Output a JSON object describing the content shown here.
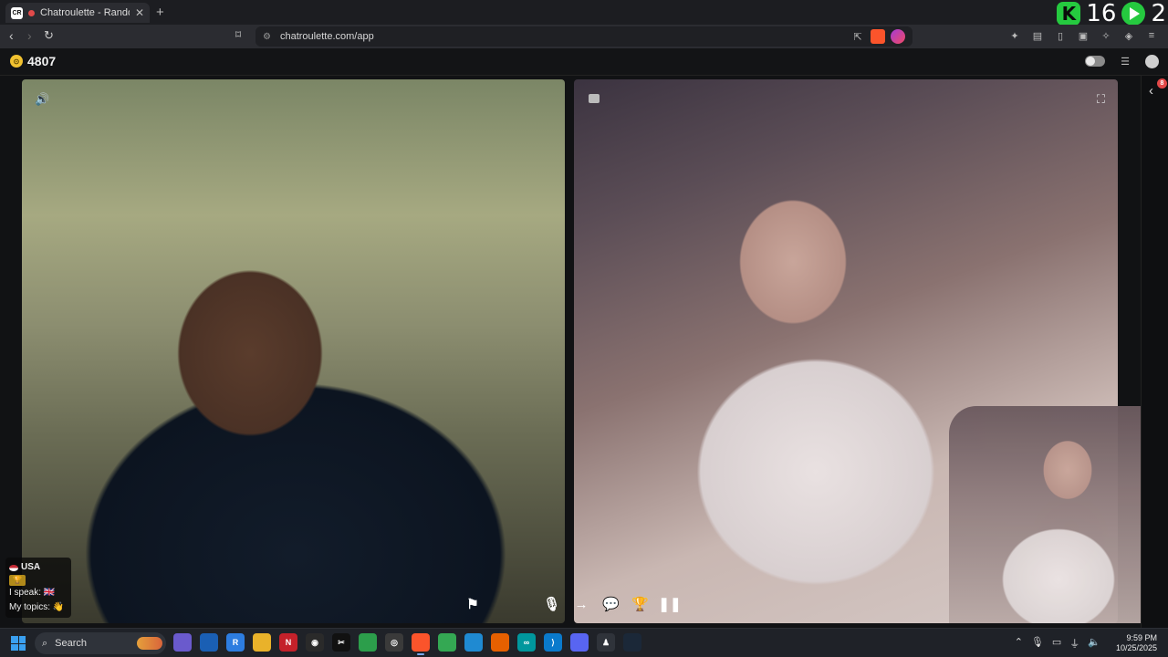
{
  "browser": {
    "tab_title": "Chatroulette - Random video",
    "tab_favicon": "CR",
    "url": "chatroulette.com/app",
    "tab_close": "✕",
    "new_tab": "+"
  },
  "overlay": {
    "counter_k_icon": "K",
    "counter_k": "16",
    "counter_play": "2"
  },
  "app": {
    "coins": "4807",
    "coin_icon": "coin-icon",
    "notifications_badge": "8"
  },
  "partner": {
    "country": "USA",
    "speaks_label": "I speak:",
    "topics_label": "My topics:",
    "topics_emoji": "👋",
    "speaks_flag": "🇬🇧"
  },
  "controls": [
    "flag-icon",
    "microphone-icon",
    "next-arrow-icon",
    "chat-icon",
    "gift-icon",
    "pause-icon"
  ],
  "taskbar": {
    "search_placeholder": "Search",
    "time": "9:59 PM",
    "date": "10/25/2025",
    "apps": [
      {
        "name": "app-copilot",
        "color": "#6a5acd",
        "label": ""
      },
      {
        "name": "app-outlook",
        "color": "#1a5fb4",
        "label": ""
      },
      {
        "name": "app-remote",
        "color": "#2d7de0",
        "label": "R"
      },
      {
        "name": "app-explorer",
        "color": "#e9b22a",
        "label": ""
      },
      {
        "name": "app-netflix",
        "color": "#c4212a",
        "label": "N"
      },
      {
        "name": "app-obs",
        "color": "#2a2a2a",
        "label": "◉"
      },
      {
        "name": "app-capcut",
        "color": "#111111",
        "label": "✂"
      },
      {
        "name": "app-maps",
        "color": "#2c9e4b",
        "label": ""
      },
      {
        "name": "app-obs2",
        "color": "#3a3a3a",
        "label": "◎"
      },
      {
        "name": "app-brave",
        "color": "#fb542b",
        "label": ""
      },
      {
        "name": "app-chrome",
        "color": "#34a853",
        "label": ""
      },
      {
        "name": "app-edge",
        "color": "#1f8ad2",
        "label": ""
      },
      {
        "name": "app-firefox",
        "color": "#e66000",
        "label": ""
      },
      {
        "name": "app-arduino",
        "color": "#00979d",
        "label": "∞"
      },
      {
        "name": "app-vscode",
        "color": "#0a7acc",
        "label": "⟩"
      },
      {
        "name": "app-discord",
        "color": "#5865f2",
        "label": ""
      },
      {
        "name": "app-accessibility",
        "color": "#2f333a",
        "label": "♟"
      },
      {
        "name": "app-steam",
        "color": "#1b2838",
        "label": ""
      }
    ]
  }
}
